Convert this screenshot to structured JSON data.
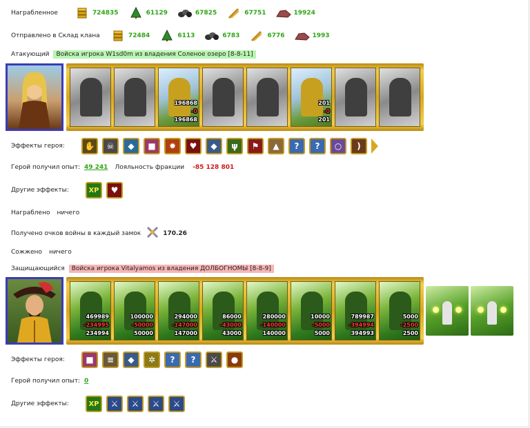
{
  "loot": {
    "label": "Награбленное",
    "values": [
      "724835",
      "61129",
      "67825",
      "67751",
      "19924"
    ]
  },
  "sent": {
    "label": "Отправлено в Склад клана",
    "values": [
      "72484",
      "6113",
      "6783",
      "6776",
      "1993"
    ]
  },
  "resource_icons": [
    "gold-coins-icon",
    "wood-tree-icon",
    "ore-icon",
    "wheat-icon",
    "stone-icon"
  ],
  "attacker": {
    "label": "Атакующий",
    "army": "Войска игрока W1sd0m из владения Соленое озеро [8-8-11]",
    "units": [
      {
        "style": "gray",
        "n1": "",
        "n2": "",
        "n3": ""
      },
      {
        "style": "gray",
        "n1": "",
        "n2": "",
        "n3": ""
      },
      {
        "style": "col",
        "n1": "196868",
        "n2": "-0",
        "n3": "196868"
      },
      {
        "style": "gray",
        "n1": "",
        "n2": "",
        "n3": ""
      },
      {
        "style": "gray",
        "n1": "",
        "n2": "",
        "n3": ""
      },
      {
        "style": "col",
        "n1": "201",
        "n2": "-0",
        "n3": "201"
      },
      {
        "style": "gray",
        "n1": "",
        "n2": "",
        "n3": ""
      },
      {
        "style": "gray",
        "n1": "",
        "n2": "",
        "n3": ""
      }
    ],
    "effects_label": "Эффекты героя:",
    "effect_icons": [
      "glove-icon",
      "skull-icon",
      "gem-icon",
      "chest-icon",
      "fire-icon",
      "heart-icon",
      "shield-icon",
      "claw-icon",
      "banner-icon",
      "armor-icon",
      "question-icon",
      "question-icon",
      "ring-icon",
      "bow-icon"
    ],
    "exp_label": "Герой получил опыт:",
    "exp_value": "49 241",
    "loyalty_label": "Лояльность фракции",
    "loyalty_value": "-85 128 801",
    "other_label": "Другие эффекты:",
    "other_icons": [
      "xp-icon",
      "heart-sword-icon"
    ],
    "looted_label": "Награблено",
    "looted_value": "ничего",
    "war_label": "Получено очков войны в каждый замок",
    "war_value": "170.26",
    "burned_label": "Сожжено",
    "burned_value": "ничего"
  },
  "defender": {
    "label": "Защищающийся",
    "army": "Войска игрока Vitalyamos из владения ДОЛБОГНОМЫ [8-8-9]",
    "units": [
      {
        "style": "grn",
        "n1": "469989",
        "n2": "-234995",
        "n3": "234994"
      },
      {
        "style": "grn",
        "n1": "100000",
        "n2": "-50000",
        "n3": "50000"
      },
      {
        "style": "grn",
        "n1": "294000",
        "n2": "-147000",
        "n3": "147000"
      },
      {
        "style": "grn",
        "n1": "86000",
        "n2": "-43000",
        "n3": "43000"
      },
      {
        "style": "grn",
        "n1": "280000",
        "n2": "-140000",
        "n3": "140000"
      },
      {
        "style": "grn",
        "n1": "10000",
        "n2": "-5000",
        "n3": "5000"
      },
      {
        "style": "grn",
        "n1": "789987",
        "n2": "-394994",
        "n3": "394993"
      },
      {
        "style": "grn",
        "n1": "5000",
        "n2": "-2500",
        "n3": "2500"
      }
    ],
    "effects_label": "Эффекты героя:",
    "effect_icons": [
      "chest-icon",
      "scroll-icon",
      "shield-icon",
      "butterfly-icon",
      "question-icon",
      "question-icon",
      "blade-icon",
      "round-shield-icon"
    ],
    "exp_label": "Герой получил опыт:",
    "exp_value": "0",
    "other_label": "Другие эффекты:",
    "other_icons": [
      "xp-icon",
      "sword-icon",
      "sword-icon",
      "sword-icon",
      "sword-icon"
    ]
  }
}
